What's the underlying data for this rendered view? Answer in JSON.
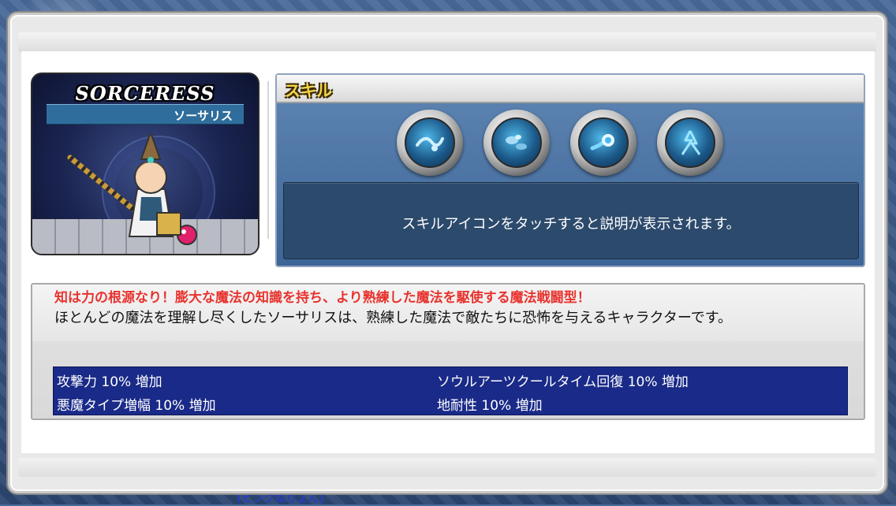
{
  "character": {
    "class_title": "SORCERESS",
    "class_name_jp": "ソーサリス"
  },
  "skills": {
    "header_label": "スキル",
    "icons": [
      "water-swirl-icon",
      "blue-stone-icon",
      "fireball-icon",
      "lightning-icon"
    ],
    "hint_text": "スキルアイコンをタッチすると説明が表示されます。"
  },
  "description": {
    "tagline": "知は力の根源なり！膨大な魔法の知識を持ち、より熟練した魔法を駆使する魔法戦闘型！",
    "body": "ほとんどの魔法を理解し尽くしたソーサリスは、熟練した魔法で敵たちに恐怖を与えるキャラクターです。"
  },
  "stats": [
    "攻撃力 10% 増加",
    "ソウルアーツクールタイム回復 10% 増加",
    "悪魔タイプ増幅 10% 増加",
    "地耐性 10% 増加"
  ],
  "background": {
    "footer_text": "(ピンクねりょん)"
  },
  "colors": {
    "stats_bg": "#1a2a88",
    "tagline": "#e8332e",
    "skill_panel": "#4a74a6"
  }
}
